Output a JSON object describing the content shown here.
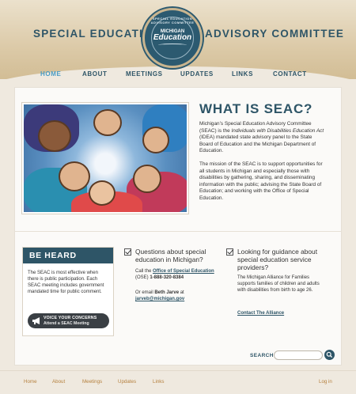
{
  "header": {
    "title_left": "SPECIAL EDUCATION",
    "title_right": "ADVISORY COMMITTEE",
    "seal": {
      "ring_text": "SPECIAL EDUCATION ADVISORY COMMITTEE",
      "michigan": "MICHIGAN",
      "education": "Education"
    }
  },
  "nav": {
    "items": [
      {
        "label": "HOME",
        "active": true
      },
      {
        "label": "ABOUT"
      },
      {
        "label": "MEETINGS"
      },
      {
        "label": "UPDATES"
      },
      {
        "label": "LINKS"
      },
      {
        "label": "CONTACT"
      }
    ]
  },
  "main": {
    "title": "WHAT IS SEAC?",
    "intro_p1_a": "Michigan’s Special Education Advisory Committee (SEAC) is the ",
    "intro_p1_italic": "Individuals with Disabilities Education Act",
    "intro_p1_b": " (IDEA) mandated state advisory panel to the State Board of Education and the Michigan Department of Education.",
    "intro_p2": "The mission of the SEAC is to support opportunities for all students in Michigan and especially those with disabilities by gathering, sharing, and disseminating information with the public; advising the State Board of Education; and working with the Office of Special Education."
  },
  "be_heard": {
    "heading": "BE HEARD",
    "text": "The SEAC is most effective when there is public participation. Each SEAC meeting includes government mandated time for public comment.",
    "button_line1": "VOICE YOUR CONCERNS",
    "button_line2": "Attend a SEAC Meeting"
  },
  "questions": {
    "heading": "Questions about special education in Michigan?",
    "call_prefix": "Call the ",
    "call_link": "Office of Special Education",
    "call_suffix": " (OSE) ",
    "phone": "1-888-320-8384",
    "email_prefix": "Or email ",
    "email_name": "Beth Jarve",
    "email_at": " at",
    "email_link": "jarveb@michigan.gov"
  },
  "guidance": {
    "heading": "Looking for guidance about special education service providers?",
    "text": "The Michigan Alliance for Families supports families of children and adults with disabilities from birth to age 26.",
    "link": "Contact The Alliance"
  },
  "search": {
    "label": "SEARCH",
    "placeholder": ""
  },
  "footer": {
    "links": [
      "Home",
      "About",
      "Meetings",
      "Updates",
      "Links"
    ],
    "login": "Log in"
  },
  "colors": {
    "brand_blue": "#2e5567",
    "active_nav": "#4a9cc4",
    "footer_link": "#b5803e",
    "header_tan": "#d2bd95"
  }
}
